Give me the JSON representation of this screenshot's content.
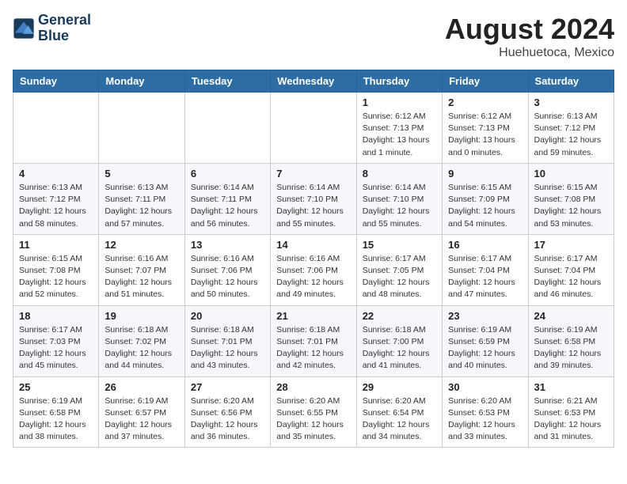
{
  "header": {
    "logo_line1": "General",
    "logo_line2": "Blue",
    "month_year": "August 2024",
    "location": "Huehuetoca, Mexico"
  },
  "days_of_week": [
    "Sunday",
    "Monday",
    "Tuesday",
    "Wednesday",
    "Thursday",
    "Friday",
    "Saturday"
  ],
  "weeks": [
    [
      {
        "day": "",
        "info": ""
      },
      {
        "day": "",
        "info": ""
      },
      {
        "day": "",
        "info": ""
      },
      {
        "day": "",
        "info": ""
      },
      {
        "day": "1",
        "info": "Sunrise: 6:12 AM\nSunset: 7:13 PM\nDaylight: 13 hours\nand 1 minute."
      },
      {
        "day": "2",
        "info": "Sunrise: 6:12 AM\nSunset: 7:13 PM\nDaylight: 13 hours\nand 0 minutes."
      },
      {
        "day": "3",
        "info": "Sunrise: 6:13 AM\nSunset: 7:12 PM\nDaylight: 12 hours\nand 59 minutes."
      }
    ],
    [
      {
        "day": "4",
        "info": "Sunrise: 6:13 AM\nSunset: 7:12 PM\nDaylight: 12 hours\nand 58 minutes."
      },
      {
        "day": "5",
        "info": "Sunrise: 6:13 AM\nSunset: 7:11 PM\nDaylight: 12 hours\nand 57 minutes."
      },
      {
        "day": "6",
        "info": "Sunrise: 6:14 AM\nSunset: 7:11 PM\nDaylight: 12 hours\nand 56 minutes."
      },
      {
        "day": "7",
        "info": "Sunrise: 6:14 AM\nSunset: 7:10 PM\nDaylight: 12 hours\nand 55 minutes."
      },
      {
        "day": "8",
        "info": "Sunrise: 6:14 AM\nSunset: 7:10 PM\nDaylight: 12 hours\nand 55 minutes."
      },
      {
        "day": "9",
        "info": "Sunrise: 6:15 AM\nSunset: 7:09 PM\nDaylight: 12 hours\nand 54 minutes."
      },
      {
        "day": "10",
        "info": "Sunrise: 6:15 AM\nSunset: 7:08 PM\nDaylight: 12 hours\nand 53 minutes."
      }
    ],
    [
      {
        "day": "11",
        "info": "Sunrise: 6:15 AM\nSunset: 7:08 PM\nDaylight: 12 hours\nand 52 minutes."
      },
      {
        "day": "12",
        "info": "Sunrise: 6:16 AM\nSunset: 7:07 PM\nDaylight: 12 hours\nand 51 minutes."
      },
      {
        "day": "13",
        "info": "Sunrise: 6:16 AM\nSunset: 7:06 PM\nDaylight: 12 hours\nand 50 minutes."
      },
      {
        "day": "14",
        "info": "Sunrise: 6:16 AM\nSunset: 7:06 PM\nDaylight: 12 hours\nand 49 minutes."
      },
      {
        "day": "15",
        "info": "Sunrise: 6:17 AM\nSunset: 7:05 PM\nDaylight: 12 hours\nand 48 minutes."
      },
      {
        "day": "16",
        "info": "Sunrise: 6:17 AM\nSunset: 7:04 PM\nDaylight: 12 hours\nand 47 minutes."
      },
      {
        "day": "17",
        "info": "Sunrise: 6:17 AM\nSunset: 7:04 PM\nDaylight: 12 hours\nand 46 minutes."
      }
    ],
    [
      {
        "day": "18",
        "info": "Sunrise: 6:17 AM\nSunset: 7:03 PM\nDaylight: 12 hours\nand 45 minutes."
      },
      {
        "day": "19",
        "info": "Sunrise: 6:18 AM\nSunset: 7:02 PM\nDaylight: 12 hours\nand 44 minutes."
      },
      {
        "day": "20",
        "info": "Sunrise: 6:18 AM\nSunset: 7:01 PM\nDaylight: 12 hours\nand 43 minutes."
      },
      {
        "day": "21",
        "info": "Sunrise: 6:18 AM\nSunset: 7:01 PM\nDaylight: 12 hours\nand 42 minutes."
      },
      {
        "day": "22",
        "info": "Sunrise: 6:18 AM\nSunset: 7:00 PM\nDaylight: 12 hours\nand 41 minutes."
      },
      {
        "day": "23",
        "info": "Sunrise: 6:19 AM\nSunset: 6:59 PM\nDaylight: 12 hours\nand 40 minutes."
      },
      {
        "day": "24",
        "info": "Sunrise: 6:19 AM\nSunset: 6:58 PM\nDaylight: 12 hours\nand 39 minutes."
      }
    ],
    [
      {
        "day": "25",
        "info": "Sunrise: 6:19 AM\nSunset: 6:58 PM\nDaylight: 12 hours\nand 38 minutes."
      },
      {
        "day": "26",
        "info": "Sunrise: 6:19 AM\nSunset: 6:57 PM\nDaylight: 12 hours\nand 37 minutes."
      },
      {
        "day": "27",
        "info": "Sunrise: 6:20 AM\nSunset: 6:56 PM\nDaylight: 12 hours\nand 36 minutes."
      },
      {
        "day": "28",
        "info": "Sunrise: 6:20 AM\nSunset: 6:55 PM\nDaylight: 12 hours\nand 35 minutes."
      },
      {
        "day": "29",
        "info": "Sunrise: 6:20 AM\nSunset: 6:54 PM\nDaylight: 12 hours\nand 34 minutes."
      },
      {
        "day": "30",
        "info": "Sunrise: 6:20 AM\nSunset: 6:53 PM\nDaylight: 12 hours\nand 33 minutes."
      },
      {
        "day": "31",
        "info": "Sunrise: 6:21 AM\nSunset: 6:53 PM\nDaylight: 12 hours\nand 31 minutes."
      }
    ]
  ]
}
